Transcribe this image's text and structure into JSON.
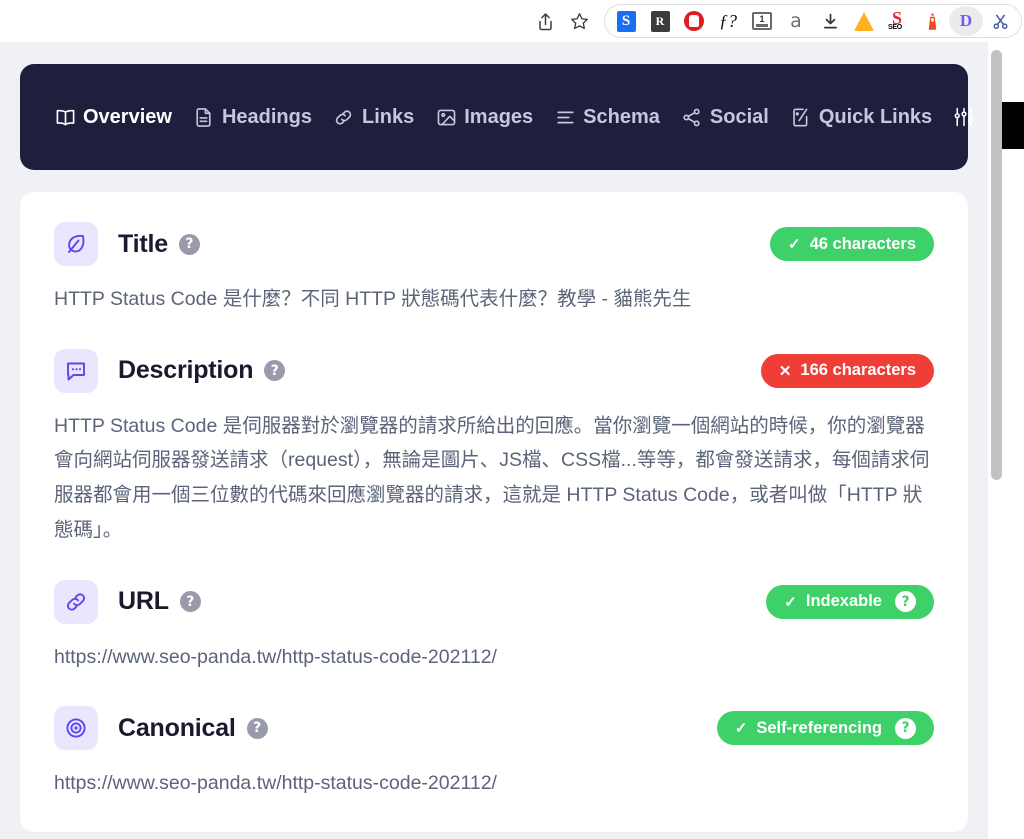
{
  "browser": {
    "toolbar_buttons": [
      {
        "name": "share-icon",
        "glyph": "⤴"
      },
      {
        "name": "bookmark-star-icon",
        "glyph": "☆"
      }
    ],
    "extensions": [
      {
        "name": "grammarly-extension-icon",
        "label": "S",
        "kind": "s"
      },
      {
        "name": "redirect-extension-icon",
        "label": "R",
        "kind": "r"
      },
      {
        "name": "adblock-extension-icon",
        "label": "",
        "kind": "stop"
      },
      {
        "name": "fonts-ninja-extension-icon",
        "label": "f?",
        "kind": "f"
      },
      {
        "name": "onetab-extension-icon",
        "label": "1",
        "kind": "book"
      },
      {
        "name": "ahrefs-extension-icon",
        "label": "a",
        "kind": "a"
      },
      {
        "name": "downloader-extension-icon",
        "label": "⬇",
        "kind": "dl"
      },
      {
        "name": "keywords-everywhere-extension-icon",
        "label": "",
        "kind": "bell"
      },
      {
        "name": "seo-quake-extension-icon",
        "label": "SEO",
        "kind": "seo"
      },
      {
        "name": "lighthouse-extension-icon",
        "label": "⛯",
        "kind": "light"
      },
      {
        "name": "detailed-seo-extension-icon",
        "label": "D",
        "kind": "d",
        "active": true
      },
      {
        "name": "extensions-overflow-icon",
        "label": "✂",
        "kind": "cut"
      }
    ]
  },
  "navbar": {
    "items": [
      {
        "label": "Overview",
        "icon": "book-open-icon",
        "active": true
      },
      {
        "label": "Headings",
        "icon": "document-icon",
        "active": false
      },
      {
        "label": "Links",
        "icon": "link-icon",
        "active": false
      },
      {
        "label": "Images",
        "icon": "image-icon",
        "active": false
      },
      {
        "label": "Schema",
        "icon": "list-lines-icon",
        "active": false
      },
      {
        "label": "Social",
        "icon": "share-nodes-icon",
        "active": false
      },
      {
        "label": "Quick Links",
        "icon": "external-doc-icon",
        "active": false
      }
    ],
    "settings_icon": "sliders-icon",
    "background_color": "#1f1f3d",
    "active_color": "#ffffff",
    "inactive_color": "#c6c6de"
  },
  "sections": [
    {
      "key": "title",
      "label": "Title",
      "icon": "leaf-icon",
      "help": "?",
      "badge": {
        "text": "46 characters",
        "status": "good",
        "tick": "✓",
        "color": "#3ed16a",
        "has_help": false
      },
      "value": "HTTP Status Code 是什麼？不同 HTTP 狀態碼代表什麼？教學 - 貓熊先生"
    },
    {
      "key": "description",
      "label": "Description",
      "icon": "chat-bubble-icon",
      "help": "?",
      "badge": {
        "text": "166 characters",
        "status": "bad",
        "tick": "✕",
        "color": "#ef3e36",
        "has_help": false
      },
      "value": "HTTP Status Code 是伺服器對於瀏覽器的請求所給出的回應。當你瀏覽一個網站的時候，你的瀏覽器會向網站伺服器發送請求（request），無論是圖片、JS檔、CSS檔...等等，都會發送請求，每個請求伺服器都會用一個三位數的代碼來回應瀏覽器的請求，這就是 HTTP Status Code，或者叫做「HTTP 狀態碼」。"
    },
    {
      "key": "url",
      "label": "URL",
      "icon": "chain-link-icon",
      "help": "?",
      "badge": {
        "text": "Indexable",
        "status": "good",
        "tick": "✓",
        "color": "#3ed16a",
        "has_help": true,
        "help": "?"
      },
      "value": "https://www.seo-panda.tw/http-status-code-202112/"
    },
    {
      "key": "canonical",
      "label": "Canonical",
      "icon": "target-circle-icon",
      "help": "?",
      "badge": {
        "text": "Self-referencing",
        "status": "good",
        "tick": "✓",
        "color": "#3ed16a",
        "has_help": true,
        "help": "?"
      },
      "value": "https://www.seo-panda.tw/http-status-code-202112/"
    }
  ]
}
